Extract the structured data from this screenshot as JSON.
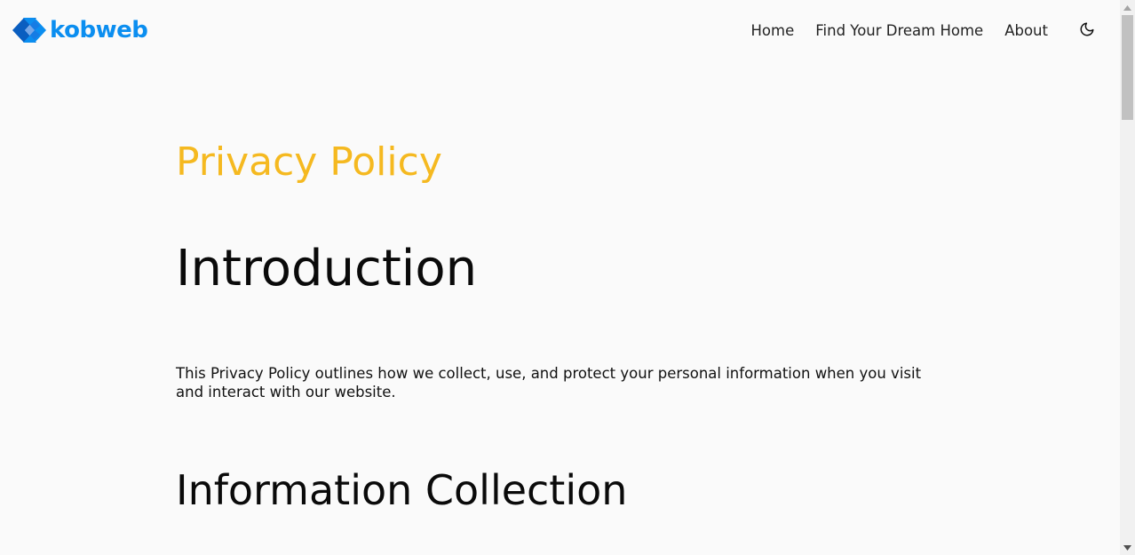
{
  "brand": {
    "name": "kobweb",
    "color": "#0b8ef0",
    "icon": "kobweb-logo-icon"
  },
  "nav": {
    "items": [
      {
        "label": "Home"
      },
      {
        "label": "Find Your Dream Home"
      },
      {
        "label": "About"
      }
    ],
    "theme_toggle_icon": "moon-icon"
  },
  "page": {
    "title": "Privacy Policy",
    "title_color": "#f5b920",
    "sections": [
      {
        "heading": "Introduction",
        "body": "This Privacy Policy outlines how we collect, use, and protect your personal information when you visit and interact with our website."
      },
      {
        "heading": "Information Collection"
      }
    ]
  },
  "scrollbar": {
    "up_icon": "scroll-up-arrow-icon",
    "down_icon": "scroll-down-arrow-icon"
  }
}
